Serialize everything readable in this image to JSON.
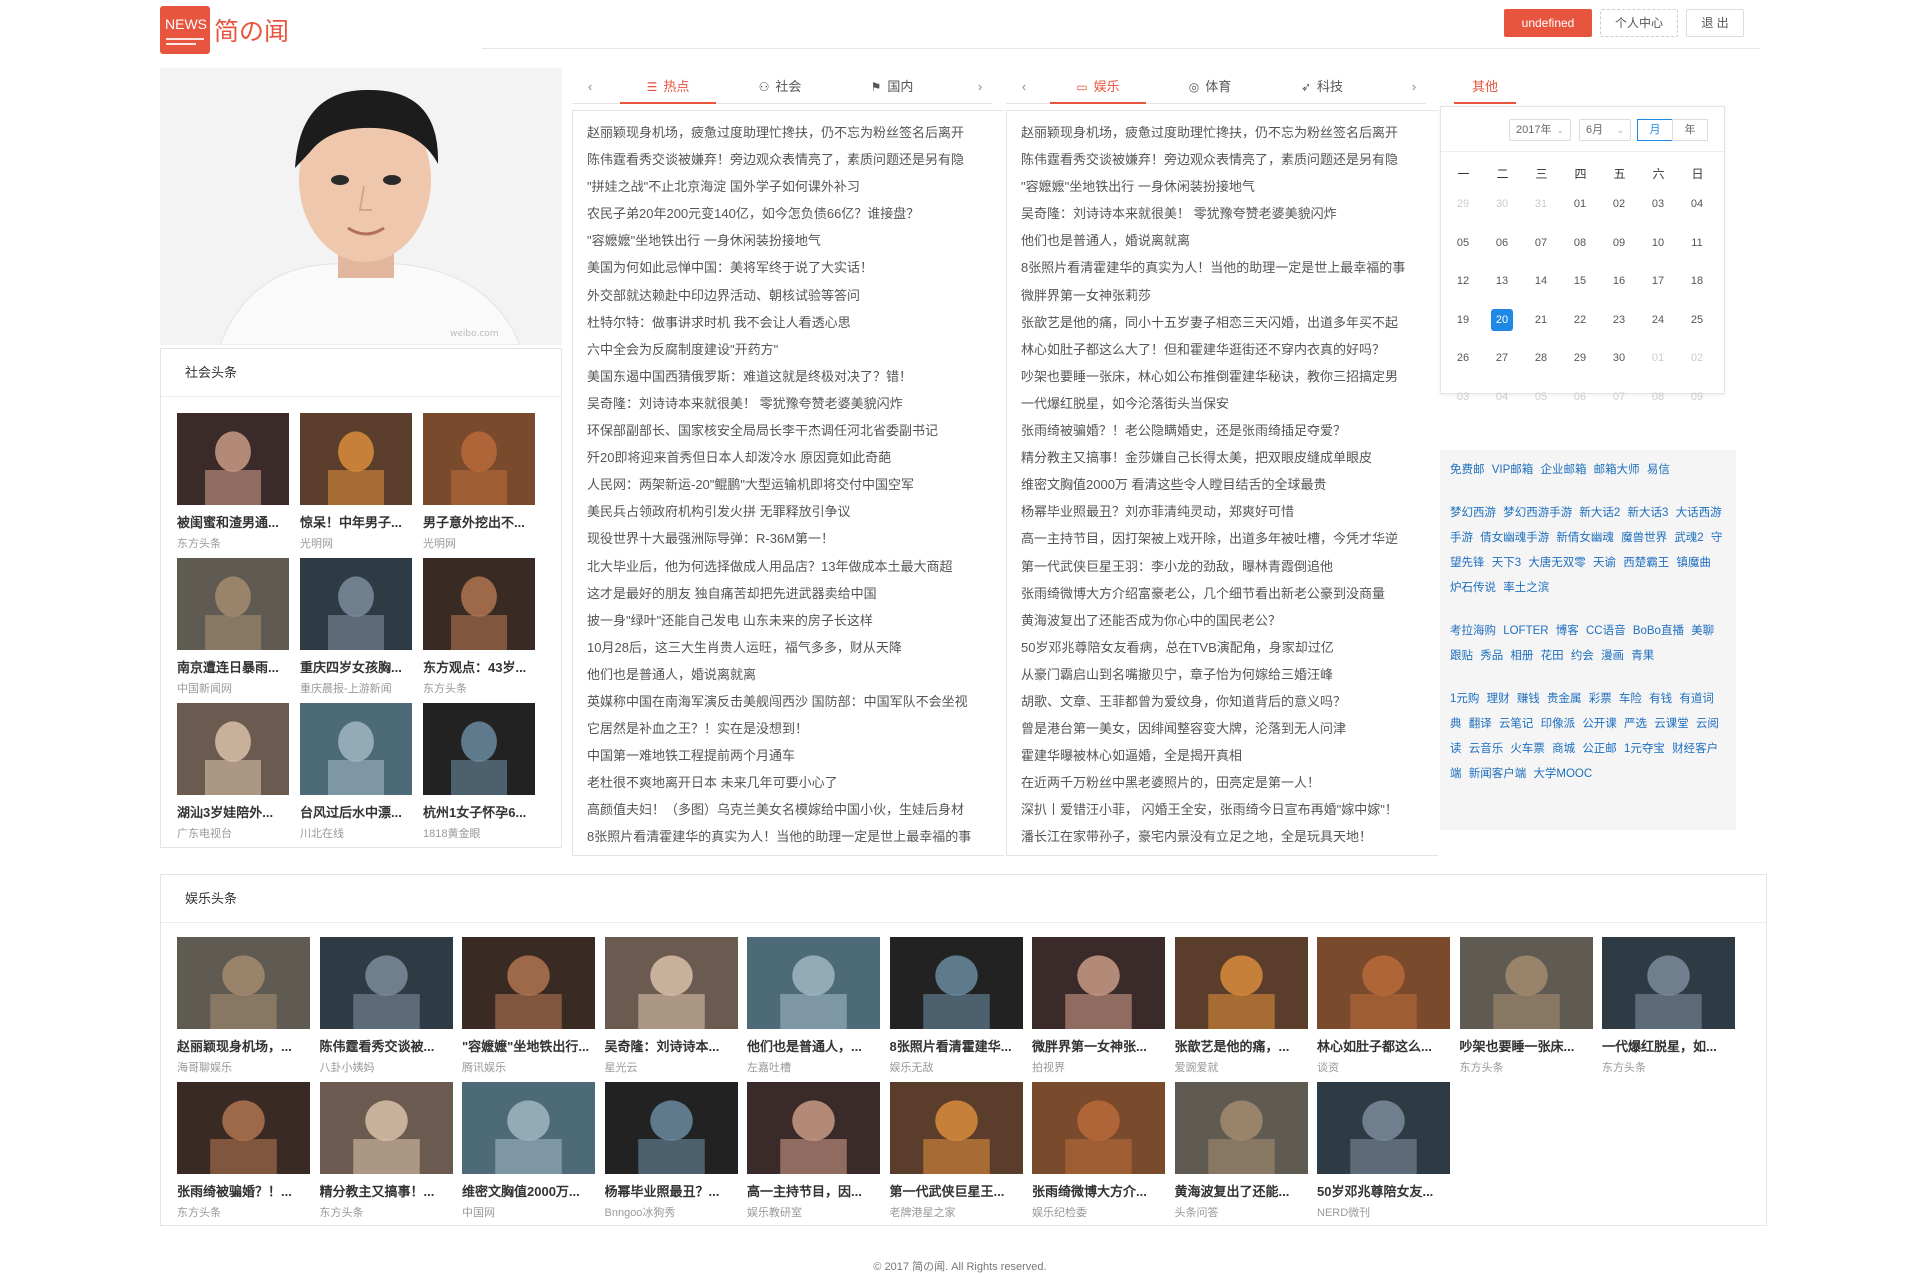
{
  "header": {
    "logo_badge": "NEWS",
    "site_name": "简の闻",
    "user_button": "undefined",
    "profile_button": "个人中心",
    "logout_button": "退 出",
    "accent_color": "#e8553f"
  },
  "profile": {
    "watermark": "weibo.com/..."
  },
  "social": {
    "title": "社会头条",
    "items": [
      {
        "title": "被闺蜜和渣男通...",
        "source": "东方头条"
      },
      {
        "title": "惊呆！中年男子...",
        "source": "光明网"
      },
      {
        "title": "男子意外挖出不...",
        "source": "光明网"
      },
      {
        "title": "南京遭连日暴雨...",
        "source": "中国新闻网"
      },
      {
        "title": "重庆四岁女孩胸...",
        "source": "重庆晨报-上游新闻"
      },
      {
        "title": "东方观点：43岁...",
        "source": "东方头条"
      },
      {
        "title": "湖汕3岁娃陪外...",
        "source": "广东电视台"
      },
      {
        "title": "台风过后水中漂...",
        "source": "川北在线"
      },
      {
        "title": "杭州1女子怀孕6...",
        "source": "1818黄金眼"
      }
    ]
  },
  "tabs1": {
    "items": [
      "热点",
      "社会",
      "国内"
    ],
    "active": 0,
    "list": [
      "赵丽颖现身机场，疲惫过度助理忙搀扶，仍不忘为粉丝签名后离开",
      "陈伟霆看秀交谈被嫌弃！旁边观众表情亮了，素质问题还是另有隐",
      "\"拼娃之战\"不止北京海淀 国外学子如何课外补习",
      "农民子弟20年200元变140亿，如今怎负债66亿？谁接盘？",
      "\"容嬷嬷\"坐地铁出行 一身休闲装扮接地气",
      "美国为何如此忌惮中国：美将军终于说了大实话！",
      "外交部就达赖赴中印边界活动、朝核试验等答问",
      "杜特尔特：做事讲求时机 我不会让人看透心思",
      "六中全会为反腐制度建设\"开药方\"",
      "美国东遏中国西猜俄罗斯：难道这就是终极对决了？错！",
      "吴奇隆：刘诗诗本来就很美！  零犹豫夸赞老婆美貌闪炸",
      "环保部副部长、国家核安全局局长李干杰调任河北省委副书记",
      "歼20即将迎来首秀但日本人却泼冷水 原因竟如此奇葩",
      "人民网：两架新运-20\"鲲鹏\"大型运输机即将交付中国空军",
      "美民兵占领政府机构引发火拼 无罪释放引争议",
      "现役世界十大最强洲际导弹：R-36M第一！",
      "北大毕业后，他为何选择做成人用品店？13年做成本土最大商超",
      "这才是最好的朋友 独自痛苦却把先进武器卖给中国",
      "披一身\"绿叶\"还能自己发电 山东未来的房子长这样",
      "10月28后，这三大生肖贵人运旺，福气多多，财从天降",
      "他们也是普通人，婚说离就离",
      "英媒称中国在南海军演反击美舰闯西沙 国防部：中国军队不会坐视",
      "它居然是补血之王？！实在是没想到！",
      "中国第一难地铁工程提前两个月通车",
      "老杜很不爽地离开日本 未来几年可要小心了",
      "高颜值夫妇！（多图）乌克兰美女名模嫁给中国小伙，生娃后身材",
      "8张照片看清霍建华的真实为人！当他的助理一定是世上最幸福的事"
    ]
  },
  "tabs2": {
    "items": [
      "娱乐",
      "体育",
      "科技"
    ],
    "active": 0,
    "list": [
      "赵丽颖现身机场，疲惫过度助理忙搀扶，仍不忘为粉丝签名后离开",
      "陈伟霆看秀交谈被嫌弃！旁边观众表情亮了，素质问题还是另有隐",
      "\"容嬷嬷\"坐地铁出行 一身休闲装扮接地气",
      "吴奇隆：刘诗诗本来就很美！  零犹豫夸赞老婆美貌闪炸",
      "他们也是普通人，婚说离就离",
      "8张照片看清霍建华的真实为人！当他的助理一定是世上最幸福的事",
      "微胖界第一女神张莉莎",
      "张歆艺是他的痛，同小十五岁妻子相恋三天闪婚，出道多年买不起",
      "林心如肚子都这么大了！但和霍建华逛街还不穿内衣真的好吗？",
      "吵架也要睡一张床，林心如公布推倒霍建华秘诀，教你三招搞定男",
      "一代爆红脱星，如今沦落街头当保安",
      "张雨绮被骗婚？！老公隐瞒婚史，还是张雨绮插足夺爱？",
      "精分教主又搞事！金莎嫌自己长得太美，把双眼皮缝成单眼皮",
      "维密文胸值2000万 看清这些令人瞠目结舌的全球最贵",
      "杨幂毕业照最丑？刘亦菲清纯灵动，郑爽好可惜",
      "高一主持节目，因打架被上戏开除，出道多年被吐槽，今凭才华逆",
      "第一代武侠巨星王羽：李小龙的劲敌，曝林青霞倒追他",
      "张雨绮微博大方介绍富豪老公，几个细节看出新老公豪到没商量",
      "黄海波复出了还能否成为你心中的国民老公？",
      "50岁邓兆尊陪女友看病，总在TVB演配角，身家却过亿",
      "从豪门霸启山到名嘴撤贝宁，章子怡为何嫁给三婚汪峰",
      "胡歌、文章、王菲都曾为爱纹身，你知道背后的意义吗？",
      "曾是港台第一美女，因绯闻整容变大牌，沦落到无人问津",
      "霍建华曝被林心如逼婚，全是揭开真相",
      "在近两千万粉丝中黑老婆照片的，田亮定是第一人！",
      "深扒丨爱错汪小菲， 闪婚王全安，张雨绮今日宣布再婚\"嫁中嫁\"！",
      "潘长江在家带孙子，豪宅内景没有立足之地，全是玩具天地！"
    ]
  },
  "tabs3": {
    "items": [
      "其他"
    ],
    "active": 0
  },
  "calendar": {
    "year_label": "2017年",
    "month_label": "6月",
    "mode_month": "月",
    "mode_year": "年",
    "weekdays": [
      "一",
      "二",
      "三",
      "四",
      "五",
      "六",
      "日"
    ],
    "today": "20",
    "rows": [
      [
        "29",
        "30",
        "31",
        "01",
        "02",
        "03",
        "04"
      ],
      [
        "05",
        "06",
        "07",
        "08",
        "09",
        "10",
        "11"
      ],
      [
        "12",
        "13",
        "14",
        "15",
        "16",
        "17",
        "18"
      ],
      [
        "19",
        "20",
        "21",
        "22",
        "23",
        "24",
        "25"
      ],
      [
        "26",
        "27",
        "28",
        "29",
        "30",
        "01",
        "02"
      ],
      [
        "03",
        "04",
        "05",
        "06",
        "07",
        "08",
        "09"
      ]
    ],
    "dim_first_row_count": 3,
    "dim_tail_start_row": 4,
    "dim_tail_start_col": 5
  },
  "links": {
    "groups": [
      [
        "免费邮",
        "VIP邮箱",
        "企业邮箱",
        "邮箱大师",
        "易信"
      ],
      [
        "梦幻西游",
        "梦幻西游手游",
        "新大话2",
        "新大话3",
        "大话西游手游",
        "倩女幽魂手游",
        "新倩女幽魂",
        "魔兽世界",
        "武魂2",
        "守望先锋",
        "天下3",
        "大唐无双零",
        "天谕",
        "西楚霸王",
        "镇魔曲",
        "炉石传说",
        "率土之滨"
      ],
      [
        "考拉海购",
        "LOFTER",
        "博客",
        "CC语音",
        "BoBo直播",
        "美聊",
        "跟贴",
        "秀品",
        "相册",
        "花田",
        "约会",
        "漫画",
        "青果"
      ],
      [
        "1元购",
        "理财",
        "赚钱",
        "贵金属",
        "彩票",
        "车险",
        "有钱",
        "有道词典",
        "翻译",
        "云笔记",
        "印像派",
        "公开课",
        "严选",
        "云课堂",
        "云阅读",
        "云音乐",
        "火车票",
        "商城",
        "公正邮",
        "1元夺宝",
        "财经客户端",
        "新闻客户端",
        "大学MOOC"
      ]
    ]
  },
  "ent": {
    "title": "娱乐头条",
    "items": [
      {
        "title": "赵丽颖现身机场，...",
        "source": "海哥聊娱乐"
      },
      {
        "title": "陈伟霆看秀交谈被...",
        "source": "八卦小姨妈"
      },
      {
        "title": "\"容嬷嬷\"坐地铁出行...",
        "source": "腾讯娱乐"
      },
      {
        "title": "吴奇隆：刘诗诗本...",
        "source": "星光云"
      },
      {
        "title": "他们也是普通人，...",
        "source": "左嘉吐槽"
      },
      {
        "title": "8张照片看清霍建华...",
        "source": "娱乐无敌"
      },
      {
        "title": "微胖界第一女神张...",
        "source": "拍视界"
      },
      {
        "title": "张歆艺是他的痛，...",
        "source": "爱豌爱就"
      },
      {
        "title": "林心如肚子都这么...",
        "source": "谈资"
      },
      {
        "title": "吵架也要睡一张床...",
        "source": "东方头条"
      },
      {
        "title": "一代爆红脱星，如...",
        "source": "东方头条"
      },
      {
        "title": "张雨绮被骗婚？！...",
        "source": "东方头条"
      },
      {
        "title": "精分教主又搞事！...",
        "source": "东方头条"
      },
      {
        "title": "维密文胸值2000万...",
        "source": "中国网"
      },
      {
        "title": "杨幂毕业照最丑？...",
        "source": "Bnngoo冰狗秀"
      },
      {
        "title": "高一主持节目，因...",
        "source": "娱乐教研室"
      },
      {
        "title": "第一代武侠巨星王...",
        "source": "老牌港星之家"
      },
      {
        "title": "张雨绮微博大方介...",
        "source": "娱乐纪检委"
      },
      {
        "title": "黄海波复出了还能...",
        "source": "头条问答"
      },
      {
        "title": "50岁邓兆尊陪女友...",
        "source": "NERD微刊"
      }
    ]
  },
  "footer": {
    "text": "© 2017 简の闻. All Rights reserved."
  }
}
